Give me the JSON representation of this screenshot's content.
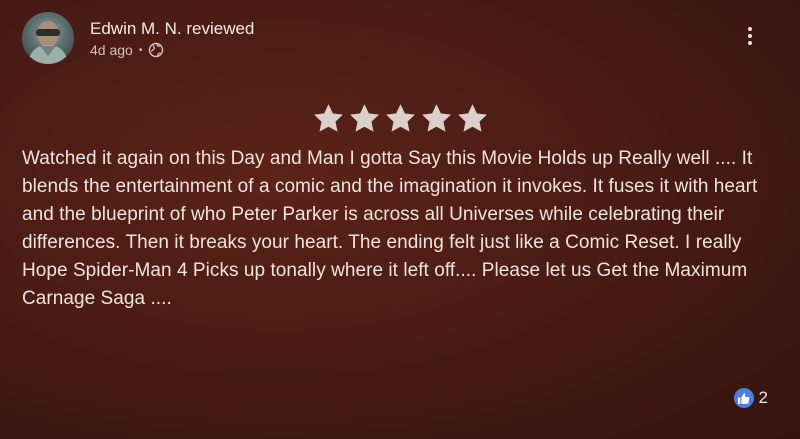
{
  "reviewer": {
    "name_line": "Edwin M. N. reviewed",
    "age": "4d ago",
    "separator": "•",
    "visibility_icon": "globe-icon"
  },
  "rating": {
    "stars": 5,
    "max": 5,
    "star_color": "#d9cfcb"
  },
  "review": {
    "text": "Watched it again on this Day and Man I gotta Say this Movie Holds up Really well .... It blends the entertainment of a comic and the imagination it invokes. It fuses it with heart and the blueprint of who Peter Parker is across all Universes while celebrating their differences. Then it breaks your heart. The ending felt just like a Comic Reset. I really Hope Spider-Man 4 Picks up tonally where it left off.... Please let us Get the Maximum Carnage Saga ...."
  },
  "reactions": {
    "like_icon": "thumbs-up-icon",
    "like_color": "#4a7fe0",
    "like_count": "2"
  },
  "menu": {
    "icon": "more-vert-icon"
  }
}
